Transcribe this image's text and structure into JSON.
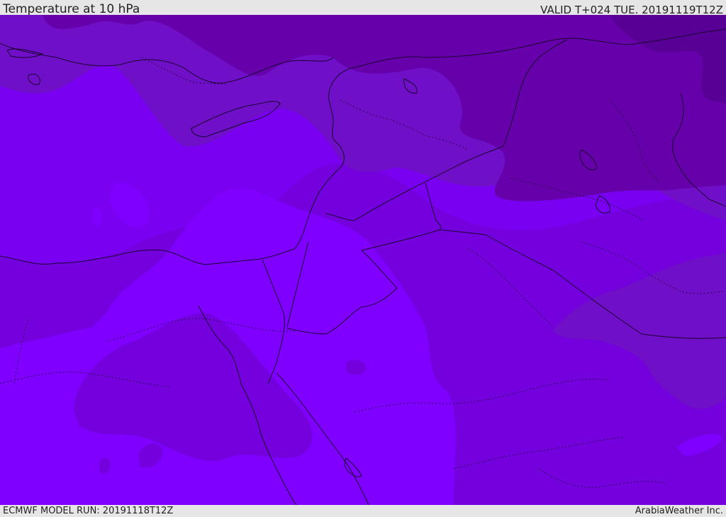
{
  "header": {
    "title": "Temperature at 10 hPa",
    "valid": "VALID T+024 TUE. 20191119T12Z"
  },
  "footer": {
    "model_run": "ECMWF MODEL RUN: 20191118T12Z",
    "credit": "ArabiaWeather Inc."
  },
  "colors": {
    "band_lightest": "#7f00ff",
    "band_light": "#7a00f2",
    "band_mid": "#7300dd",
    "band_dark": "#6f0fc8",
    "band_darker": "#6500aa",
    "band_darkest": "#580095",
    "boundaries": "#1a0030"
  }
}
